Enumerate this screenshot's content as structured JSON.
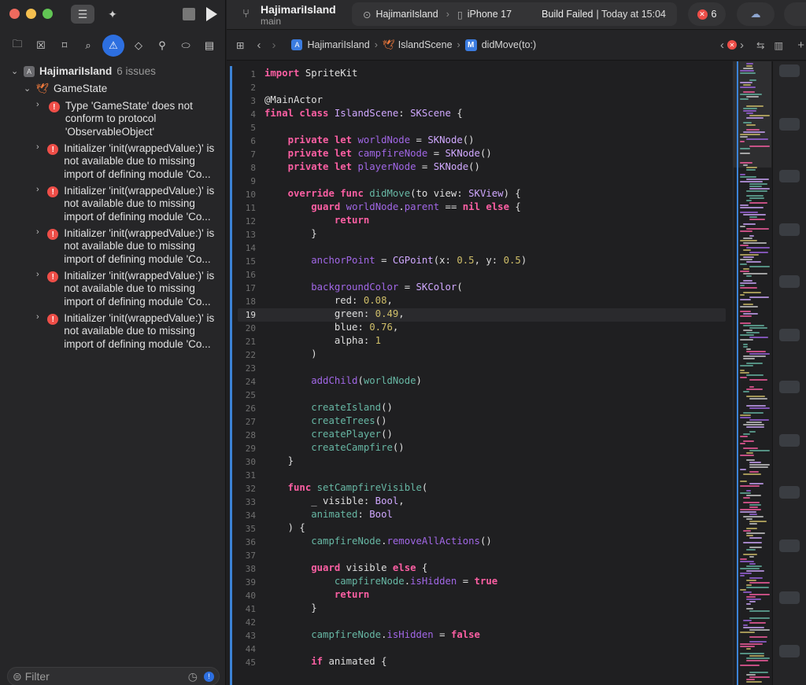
{
  "toolbar": {
    "project_title": "HajimariIsland",
    "branch": "main",
    "scheme_project": "HajimariIsland",
    "scheme_device": "iPhone 17",
    "build_status": "Build Failed",
    "build_time": "| Today at 15:04",
    "error_count": "6"
  },
  "navigator": {
    "project": "HajimariIsland",
    "issues_count": "6 issues",
    "group": "GameState",
    "issues": [
      "Type 'GameState' does not conform to protocol 'ObservableObject'",
      "Initializer 'init(wrappedValue:)' is not available due to missing import of defining module 'Co...",
      "Initializer 'init(wrappedValue:)' is not available due to missing import of defining module 'Co...",
      "Initializer 'init(wrappedValue:)' is not available due to missing import of defining module 'Co...",
      "Initializer 'init(wrappedValue:)' is not available due to missing import of defining module 'Co...",
      "Initializer 'init(wrappedValue:)' is not available due to missing import of defining module 'Co..."
    ],
    "filter_placeholder": "Filter"
  },
  "jumpbar": {
    "project": "HajimariIsland",
    "file": "IslandScene",
    "symbol": "didMove(to:)"
  },
  "editor": {
    "current_line": 19
  },
  "colors": {
    "accent": "#2d6fe0",
    "error": "#ee4e48",
    "keyword": "#fc5fa3",
    "type": "#d0a8ff",
    "function": "#67b7a4",
    "property": "#a167e6",
    "number": "#d0bf69"
  },
  "icons": [
    "branch-icon",
    "error-icon",
    "swift-file-icon",
    "filter-icon",
    "clock-icon",
    "warning-icon"
  ]
}
